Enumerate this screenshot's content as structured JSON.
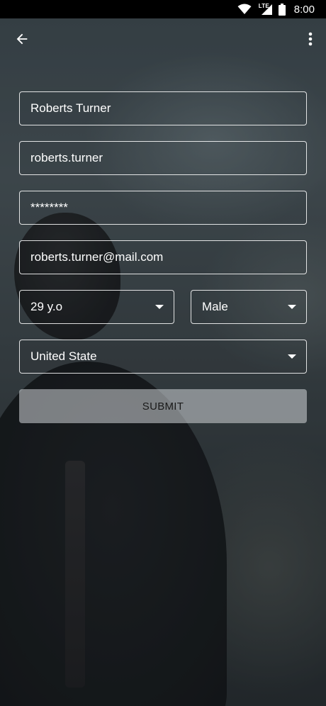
{
  "status_bar": {
    "time": "8:00",
    "network_label": "LTE",
    "icons": [
      "wifi-icon",
      "lte-signal-icon",
      "battery-icon"
    ]
  },
  "app_bar": {
    "back_icon": "arrow-back-icon",
    "menu_icon": "more-vert-icon"
  },
  "form": {
    "full_name": "Roberts Turner",
    "username": "roberts.turner",
    "password": "********",
    "email": "roberts.turner@mail.com",
    "age": "29 y.o",
    "gender": "Male",
    "country": "United State",
    "submit_label": "SUBMIT"
  },
  "colors": {
    "text": "#ffffff",
    "field_border": "#e6e6e6",
    "submit_bg": "#cfd3d5",
    "submit_text": "#1a1a1a",
    "status_bar_bg": "#000000"
  }
}
